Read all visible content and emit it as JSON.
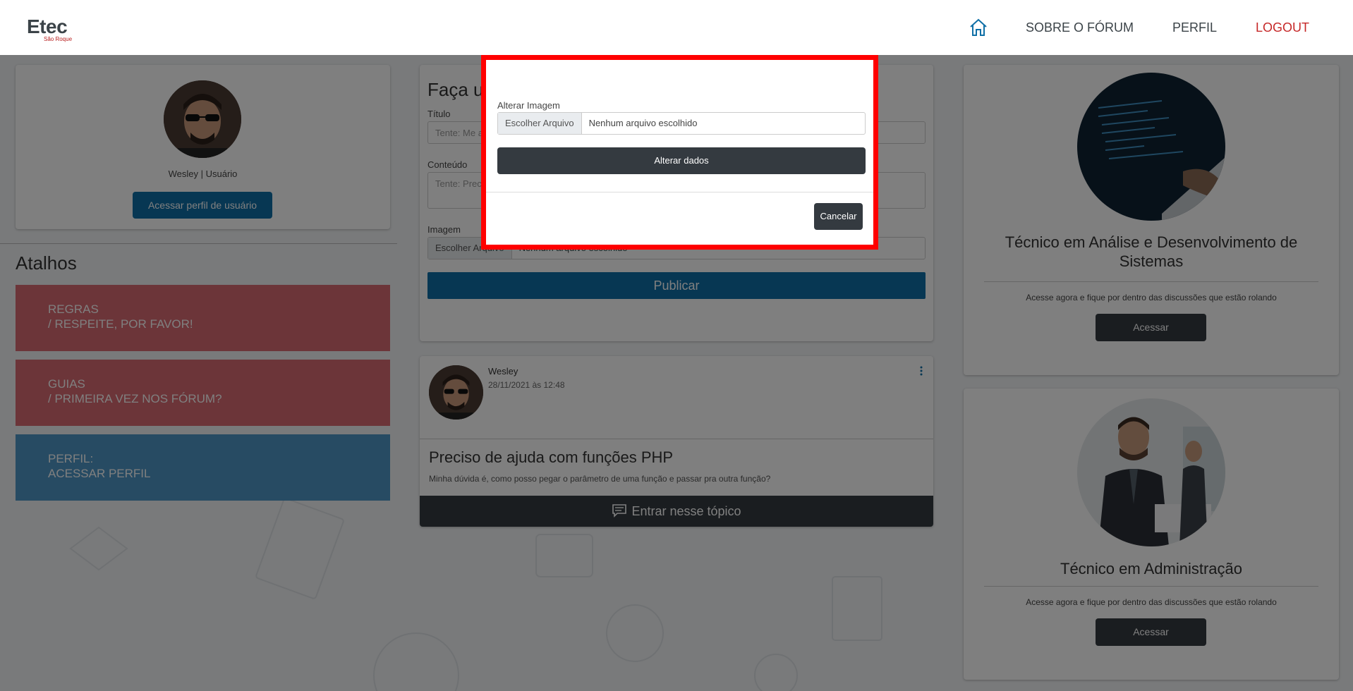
{
  "navbar": {
    "logo_main": "Etec",
    "logo_sub": "São Roque",
    "links": [
      "SOBRE O FÓRUM",
      "PERFIL",
      "LOGOUT"
    ]
  },
  "profile": {
    "name": "Wesley | Usuário",
    "button": "Acessar perfil de usuário"
  },
  "shortcuts": {
    "title": "Atalhos",
    "items": [
      {
        "line1": "REGRAS",
        "line2": "/ RESPEITE, POR FAVOR!"
      },
      {
        "line1": "GUIAS",
        "line2": "/ PRIMEIRA VEZ NOS FÓRUM?"
      },
      {
        "line1": "PERFIL:",
        "line2": "ACESSAR PERFIL"
      }
    ]
  },
  "post_form": {
    "title": "Faça u",
    "title_label": "Título",
    "title_placeholder": "Tente: Me a",
    "content_label": "Conteúdo",
    "content_placeholder": "Tente: Prec",
    "image_label": "Imagem",
    "file_button": "Escolher Arquivo",
    "file_text": "Nenhum arquivo escolhido",
    "publish_button": "Publicar"
  },
  "topic": {
    "author": "Wesley",
    "date": "28/11/2021 às 12:48",
    "title": "Preciso de ajuda com funções PHP",
    "body": "Minha dúvida é, como posso pegar o parâmetro de uma função e passar pra outra função?",
    "enter": "Entrar nesse tópico"
  },
  "courses": [
    {
      "title": "Técnico em Análise e Desenvolvimento de Sistemas",
      "desc": "Acesse agora e fique por dentro das discussões que estão rolando",
      "button": "Acessar"
    },
    {
      "title": "Técnico em Administração",
      "desc": "Acesse agora e fique por dentro das discussões que estão rolando",
      "button": "Acessar"
    }
  ],
  "modal": {
    "label": "Alterar Imagem",
    "file_button": "Escolher Arquivo",
    "file_text": "Nenhum arquivo escolhido",
    "submit": "Alterar dados",
    "cancel": "Cancelar"
  },
  "colors": {
    "primary": "#0f6fa6",
    "dark": "#343a40",
    "shortcut_red": "#d96a72",
    "shortcut_blue": "#4f97c6",
    "logout": "#c62828",
    "highlight": "#ff0000"
  }
}
